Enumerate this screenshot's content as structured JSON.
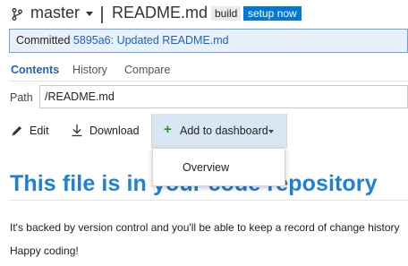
{
  "header": {
    "branch_icon": "git-branch-icon",
    "branch_name": "master",
    "file_name": "README.md",
    "badge_build": "build",
    "badge_setup": "setup now"
  },
  "commit": {
    "label": "Committed",
    "link": "5895a6: Updated README.md"
  },
  "tabs": [
    {
      "label": "Contents",
      "active": true
    },
    {
      "label": "History",
      "active": false
    },
    {
      "label": "Compare",
      "active": false
    }
  ],
  "path": {
    "label": "Path",
    "value": "/README.md"
  },
  "toolbar": {
    "edit": {
      "label": "Edit",
      "icon": "pencil-icon"
    },
    "download": {
      "label": "Download",
      "icon": "download-icon"
    },
    "add_to_dashboard": {
      "label": "Add to dashboard",
      "icon": "plus-icon"
    }
  },
  "dropdown": {
    "items": [
      {
        "label": "Overview"
      }
    ]
  },
  "content": {
    "title": "This file is in your code repository",
    "paragraphs": [
      "It's backed by version control and you'll be able to keep a record of change history",
      "Happy coding!"
    ]
  },
  "colors": {
    "accent": "#1b64c2",
    "title": "#1e80d6",
    "badge_setup_bg": "#0078d7",
    "commit_bar_bg": "#e8f1fb",
    "plus_green": "#2e8b1e"
  }
}
